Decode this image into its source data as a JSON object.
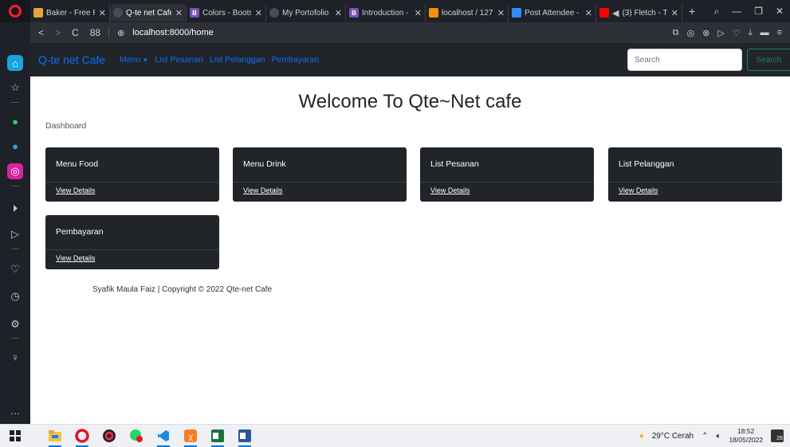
{
  "browser": {
    "tabs": [
      {
        "title": "Baker - Free Re",
        "favicon_color": "#e7a33e",
        "favicon_glyph": "",
        "active": false
      },
      {
        "title": "Q-te net Cafe",
        "favicon_color": "#4a4d55",
        "favicon_glyph": "",
        "active": true
      },
      {
        "title": "Colors - Bootstr",
        "favicon_color": "#7952b3",
        "favicon_glyph": "B",
        "active": false
      },
      {
        "title": "My Portofolio | ",
        "favicon_color": "#4a4d55",
        "favicon_glyph": "",
        "active": false
      },
      {
        "title": "Introduction - B",
        "favicon_color": "#7952b3",
        "favicon_glyph": "B",
        "active": false
      },
      {
        "title": "localhost / 127.",
        "favicon_color": "#f29111",
        "favicon_glyph": "",
        "active": false
      },
      {
        "title": "Post Attendee - ",
        "favicon_color": "#2d8cff",
        "favicon_glyph": "",
        "active": false
      },
      {
        "title": "(3) Fletch - T",
        "favicon_color": "#ff0000",
        "favicon_glyph": "",
        "active": false
      }
    ],
    "new_tab_label": "+",
    "address": {
      "back": "<",
      "forward": ">",
      "reload": "C",
      "speed_dial": "88",
      "url": "localhost:8000/home"
    }
  },
  "navbar": {
    "brand": "Q-te net Cafe",
    "links": [
      {
        "label": "Menu",
        "dropdown": true
      },
      {
        "label": "List Pesanan",
        "dropdown": false
      },
      {
        "label": "List Pelanggan",
        "dropdown": false
      },
      {
        "label": "Pembayaran",
        "dropdown": false
      }
    ],
    "search_placeholder": "Search",
    "search_button": "Search"
  },
  "page": {
    "title": "Welcome To Qte~Net cafe",
    "breadcrumb": "Dashboard",
    "cards": [
      {
        "title": "Menu Food",
        "link": "View Details"
      },
      {
        "title": "Menu Drink",
        "link": "View Details"
      },
      {
        "title": "List Pesanan",
        "link": "View Details"
      },
      {
        "title": "List Pelanggan",
        "link": "View Details"
      },
      {
        "title": "Pembayaran",
        "link": "View Details"
      }
    ],
    "footer": "Syafik Maula Faiz | Copyright © 2022 Qte-net Cafe"
  },
  "taskbar": {
    "weather": "29°C  Cerah",
    "time": "18:52",
    "date": "18/05/2022",
    "notification_count": "26"
  },
  "colors": {
    "navbar_bg": "#212529",
    "brand": "#0d6efd",
    "card_bg": "#212529",
    "search_button": "#198754"
  }
}
